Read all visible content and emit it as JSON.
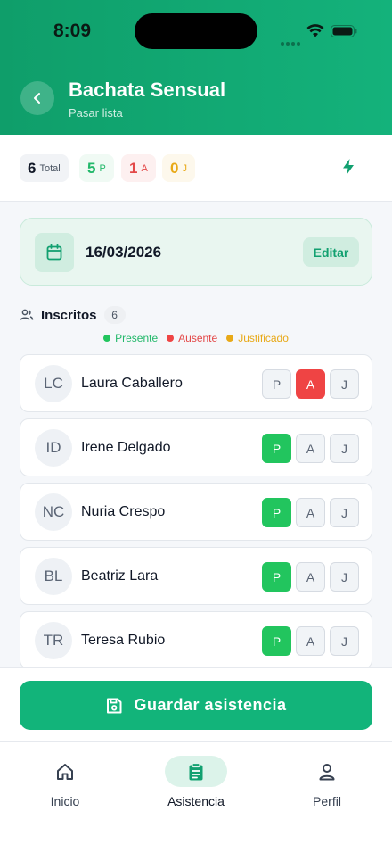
{
  "status": {
    "time": "8:09"
  },
  "header": {
    "title": "Bachata Sensual",
    "subtitle": "Pasar lista"
  },
  "stats": {
    "total": {
      "value": "6",
      "label": "Total"
    },
    "present": {
      "value": "5",
      "label": "P"
    },
    "absent": {
      "value": "1",
      "label": "A"
    },
    "justified": {
      "value": "0",
      "label": "J"
    }
  },
  "date_card": {
    "date": "16/03/2026",
    "edit_label": "Editar"
  },
  "enrolled": {
    "title": "Inscritos",
    "count": "6"
  },
  "legend": {
    "present": "Presente",
    "absent": "Ausente",
    "justified": "Justificado"
  },
  "buttons": {
    "p": "P",
    "a": "A",
    "j": "J"
  },
  "students": [
    {
      "initials": "LC",
      "name": "Laura Caballero",
      "status": "A"
    },
    {
      "initials": "ID",
      "name": "Irene Delgado",
      "status": "P"
    },
    {
      "initials": "NC",
      "name": "Nuria Crespo",
      "status": "P"
    },
    {
      "initials": "BL",
      "name": "Beatriz Lara",
      "status": "P"
    },
    {
      "initials": "TR",
      "name": "Teresa Rubio",
      "status": "P"
    }
  ],
  "save_label": "Guardar asistencia",
  "tabbar": {
    "home": "Inicio",
    "attendance": "Asistencia",
    "profile": "Perfil"
  },
  "colors": {
    "brand": "#12b47a",
    "present": "#22c55e",
    "absent": "#ef4444",
    "justified": "#e8a917"
  },
  "icons": [
    "back-arrow-icon",
    "bolt-icon",
    "calendar-icon",
    "users-icon",
    "save-icon",
    "home-icon",
    "clipboard-icon",
    "user-icon"
  ]
}
